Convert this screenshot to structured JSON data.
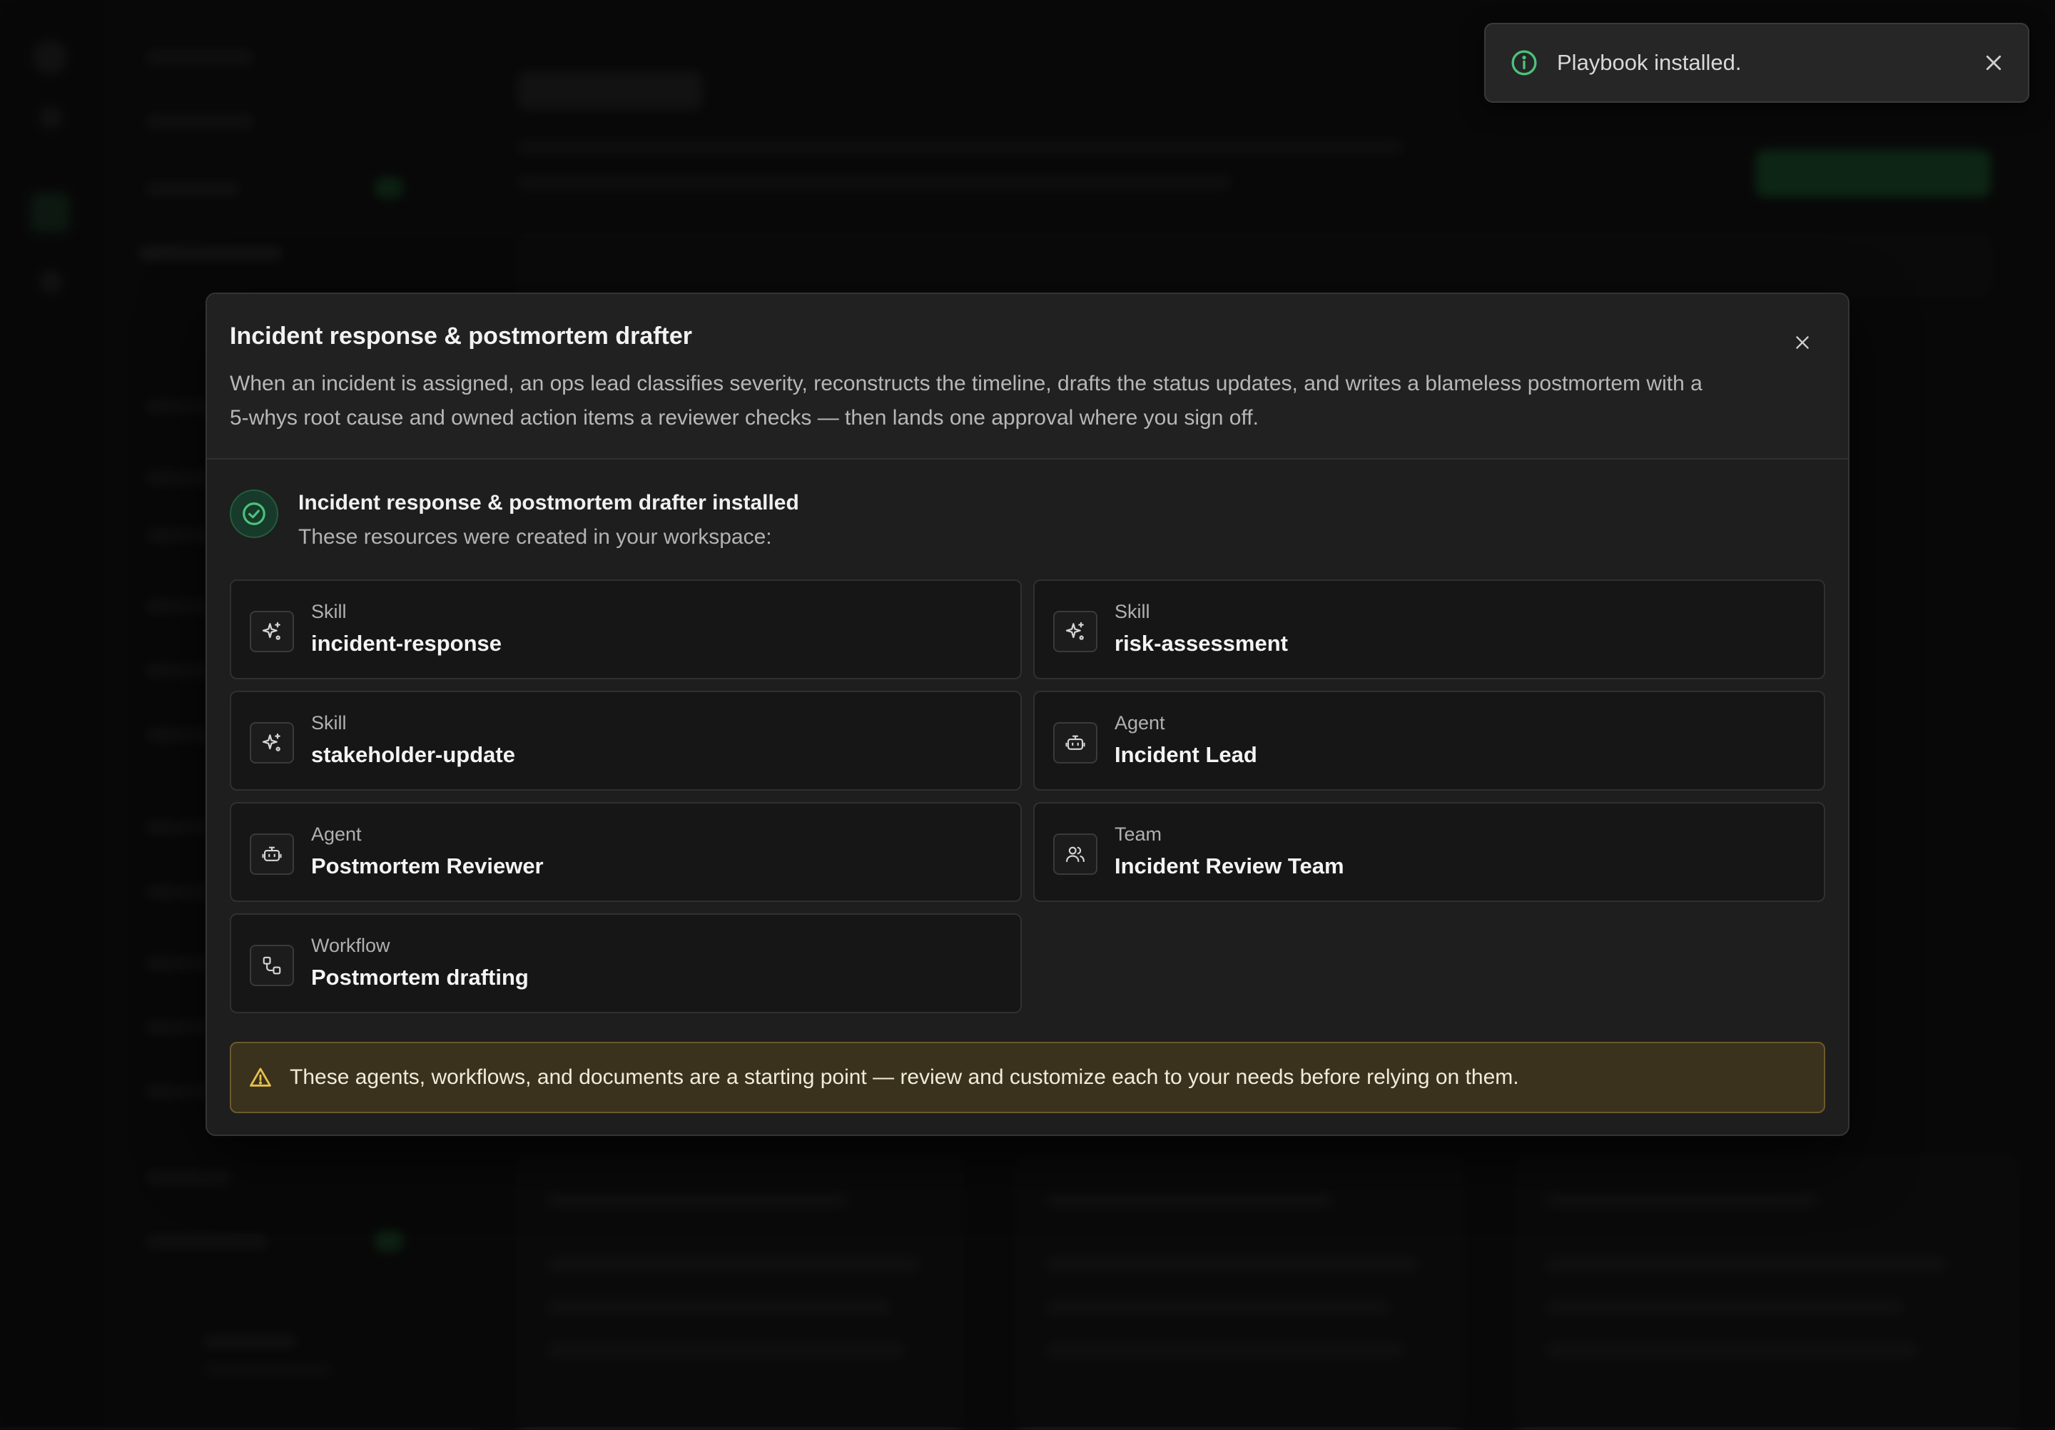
{
  "toast": {
    "message": "Playbook installed.",
    "icon": "info-icon",
    "accent": "#4cc27a"
  },
  "modal": {
    "title": "Incident response & postmortem drafter",
    "description": "When an incident is assigned, an ops lead classifies severity, reconstructs the timeline, drafts the status updates, and writes a blameless postmortem with a 5-whys root cause and owned action items a reviewer checks — then lands one approval where you sign off.",
    "success_title": "Incident response & postmortem drafter installed",
    "success_subtitle": "These resources were created in your workspace:",
    "resources": [
      {
        "kind": "Skill",
        "name": "incident-response",
        "icon": "sparkle-icon"
      },
      {
        "kind": "Skill",
        "name": "risk-assessment",
        "icon": "sparkle-icon"
      },
      {
        "kind": "Skill",
        "name": "stakeholder-update",
        "icon": "sparkle-icon"
      },
      {
        "kind": "Agent",
        "name": "Incident Lead",
        "icon": "bot-icon"
      },
      {
        "kind": "Agent",
        "name": "Postmortem Reviewer",
        "icon": "bot-icon"
      },
      {
        "kind": "Team",
        "name": "Incident Review Team",
        "icon": "users-icon"
      },
      {
        "kind": "Workflow",
        "name": "Postmortem drafting",
        "icon": "workflow-icon"
      }
    ],
    "warning": "These agents, workflows, and documents are a starting point — review and customize each to your needs before relying on them."
  },
  "colors": {
    "success": "#4cc27a",
    "warning_bg": "#3a321d",
    "warning_icon": "#e6c14d"
  }
}
